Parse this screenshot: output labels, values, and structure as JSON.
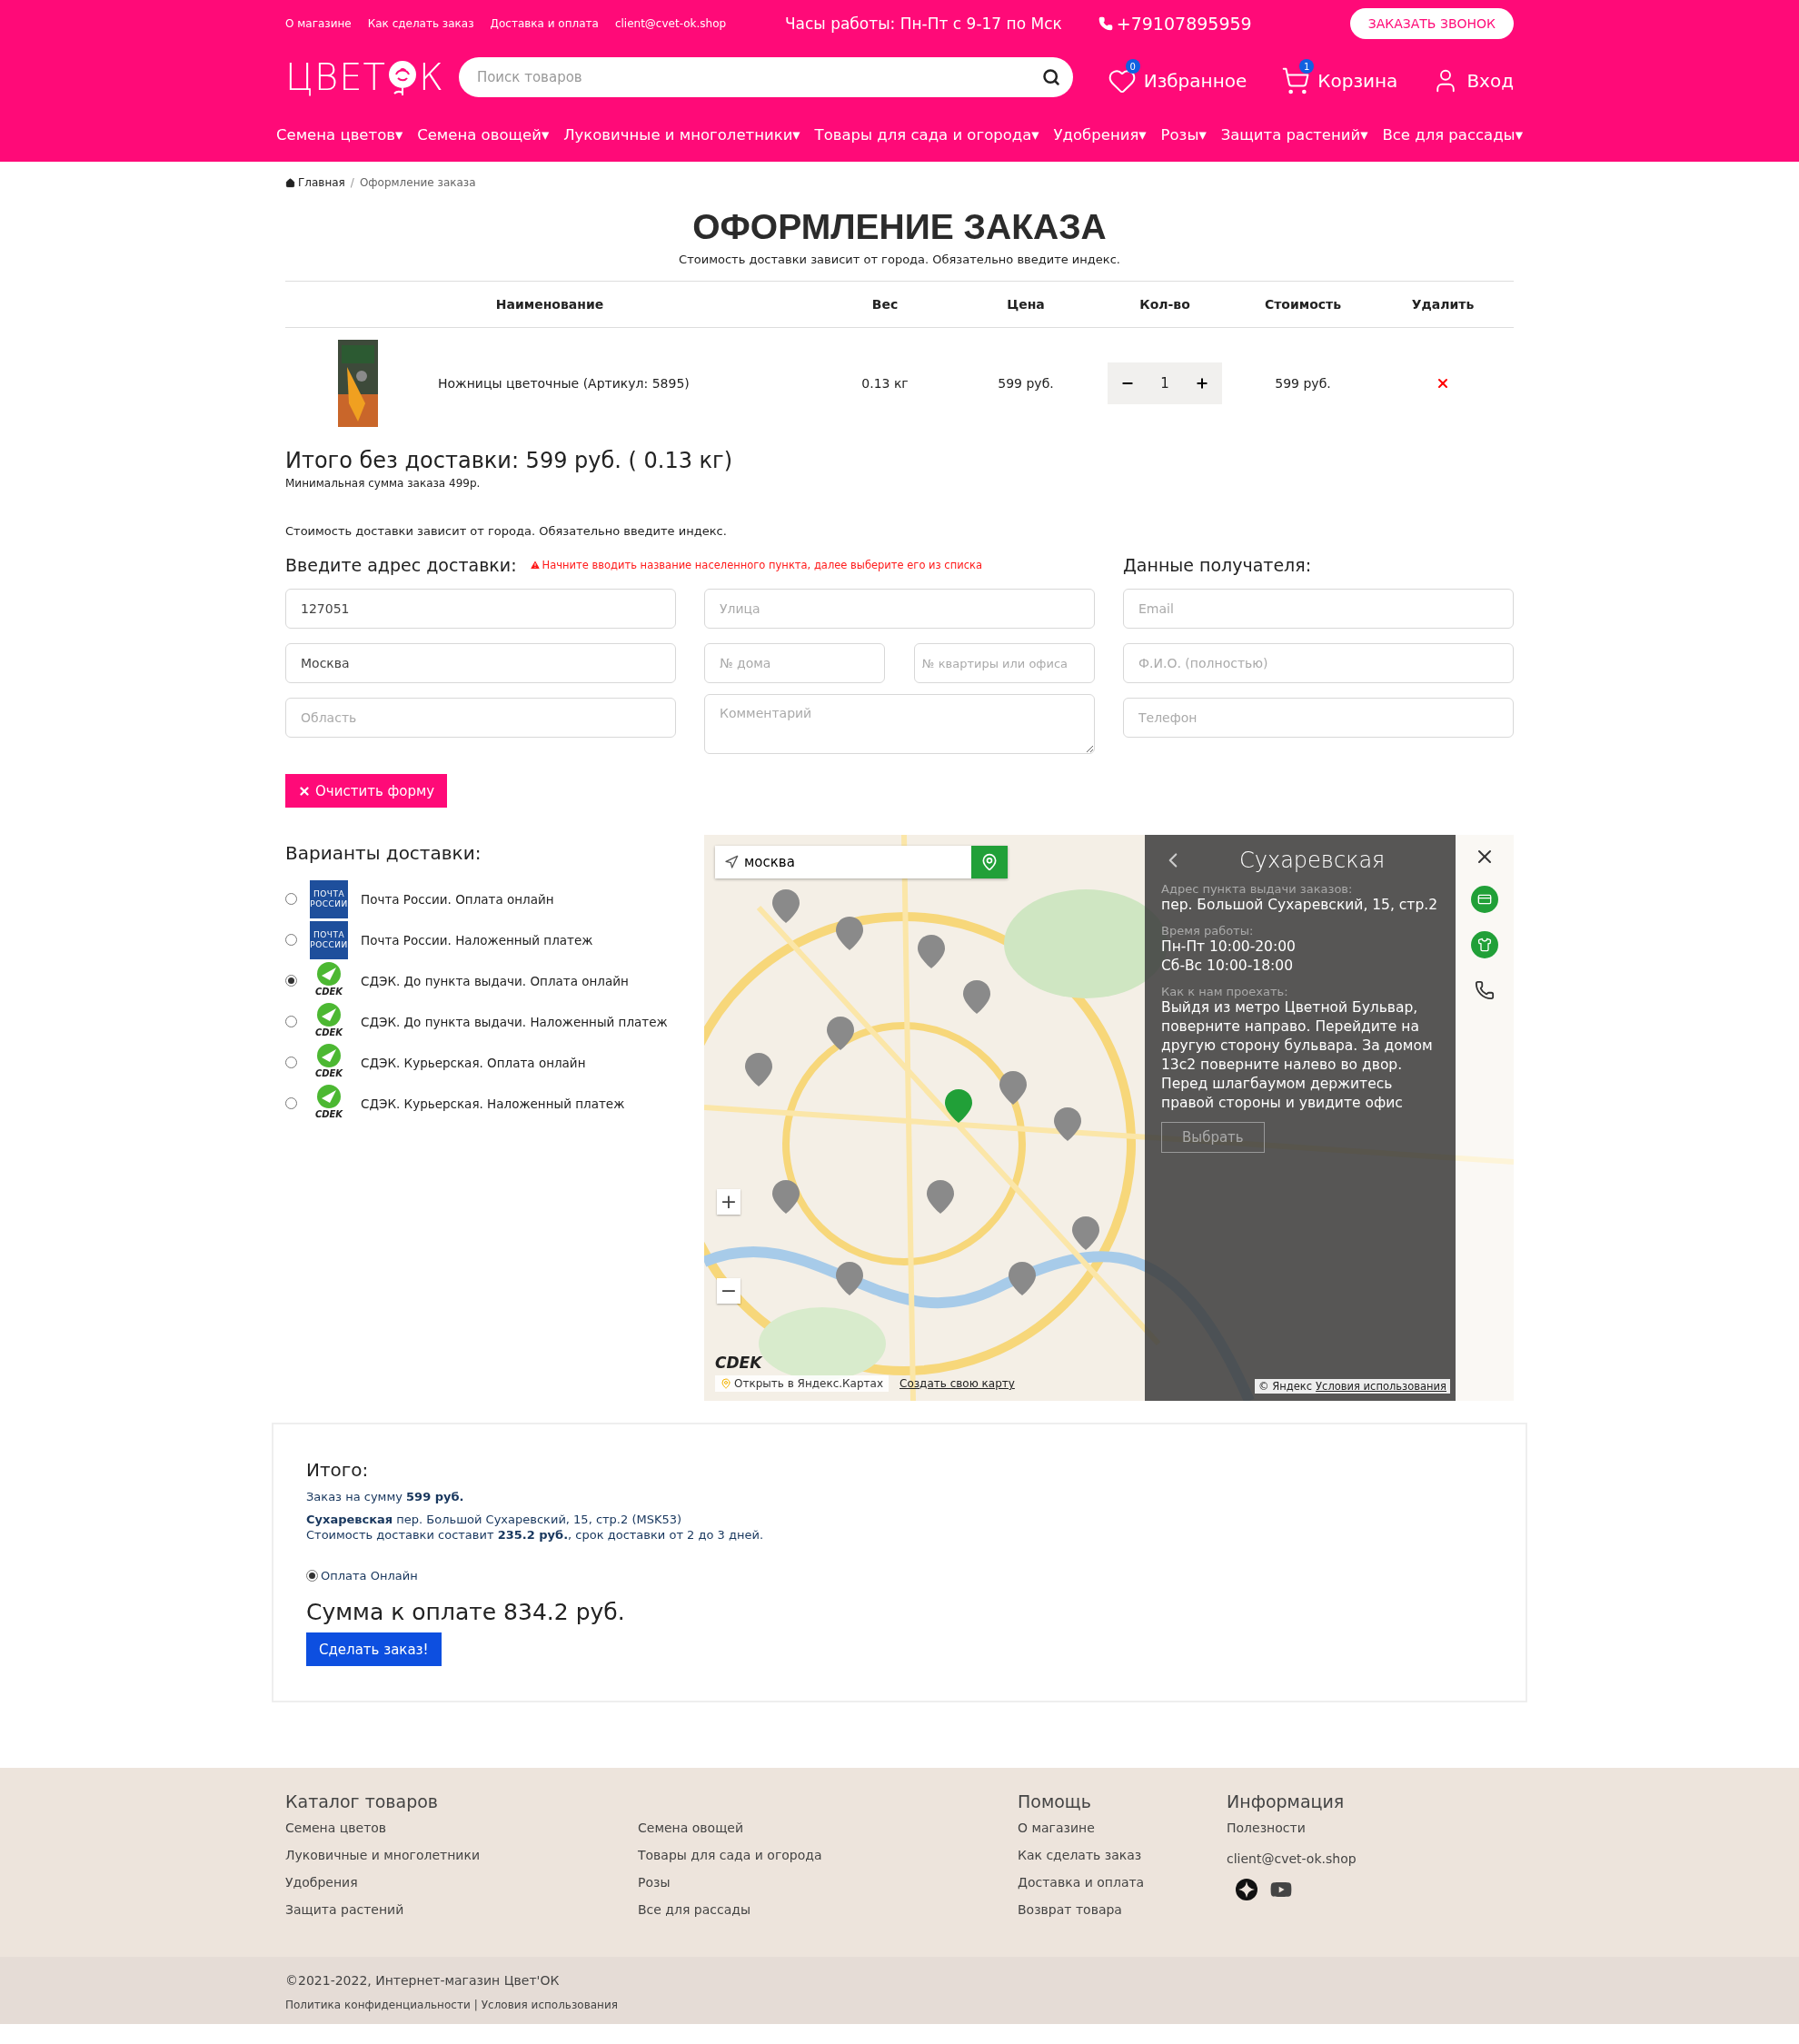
{
  "top_bar": {
    "links": [
      "О магазине",
      "Как сделать заказ",
      "Доставка и оплата",
      "client@cvet-ok.shop"
    ],
    "hours": "Часы работы: Пн-Пт с 9-17 по Мск",
    "phone": "+79107895959",
    "callback_button": "ЗАКАЗАТЬ ЗВОНОК"
  },
  "header": {
    "logo_left": "ЦВЕТ",
    "logo_right": "К",
    "search_placeholder": "Поиск товаров",
    "favorites": {
      "label": "Избранное",
      "count": "0"
    },
    "cart": {
      "label": "Корзина",
      "count": "1"
    },
    "login": "Вход"
  },
  "nav_caret": "▾",
  "breadcrumb_separator": "/",
  "nav": [
    "Семена цветов",
    "Семена овощей",
    "Луковичные и многолетники",
    "Товары для сада и огорода",
    "Удобрения",
    "Розы",
    "Защита растений",
    "Все для рассады"
  ],
  "breadcrumb": [
    {
      "label": "Главная",
      "kind": "home"
    },
    {
      "label": "Оформление заказа",
      "kind": "current"
    }
  ],
  "page": {
    "title": "ОФОРМЛЕНИЕ ЗАКАЗА",
    "subtitle": "Стоимость доставки зависит от города. Обязательно введите индекс."
  },
  "cart_table": {
    "columns": [
      "Наименование",
      "Вес",
      "Цена",
      "Кол-во",
      "Стоимость",
      "Удалить"
    ],
    "rows": [
      {
        "name": "Ножницы цветочные (Артикул: 5895)",
        "weight": "0.13 кг",
        "price": "599 руб.",
        "quantity": "1",
        "cost": "599 руб."
      }
    ]
  },
  "summary": {
    "title": "Итого без доставки: 599 руб. ( 0.13 кг)",
    "min_note": "Минимальная сумма заказа 499р."
  },
  "delivery_note": "Стоимость доставки зависит от города. Обязательно введите индекс.",
  "address": {
    "title": "Введите адрес доставки:",
    "warning": "Начните вводить название населенного пункта, далее выберите его из списка",
    "left_fields": [
      {
        "value": "127051"
      },
      {
        "value": "Москва"
      },
      {
        "placeholder": "Область"
      }
    ],
    "street": {
      "placeholder": "Улица"
    },
    "house": {
      "placeholder": "№ дома"
    },
    "flat": {
      "placeholder": "№ квартиры или офиса"
    },
    "comment": {
      "placeholder": "Комментарий"
    }
  },
  "recipient": {
    "title": "Данные получателя:",
    "fields": [
      {
        "placeholder": "Email"
      },
      {
        "placeholder": "Ф.И.О. (полностью)"
      },
      {
        "placeholder": "Телефон"
      }
    ]
  },
  "clear_button": "Очистить форму",
  "delivery": {
    "title": "Варианты доставки:",
    "options": [
      {
        "label": "Почта России. Оплата онлайн",
        "kind": "pochta",
        "logo": "ПОЧТА РОССИИ",
        "selected": false
      },
      {
        "label": "Почта России. Наложенный платеж",
        "kind": "pochta",
        "logo": "ПОЧТА РОССИИ",
        "selected": false
      },
      {
        "label": "СДЭК. До пункта выдачи. Оплата онлайн",
        "kind": "cdek",
        "logo": "CDEK",
        "selected": true
      },
      {
        "label": "СДЭК. До пункта выдачи. Наложенный платеж",
        "kind": "cdek",
        "logo": "CDEK",
        "selected": false
      },
      {
        "label": "СДЭК. Курьерская. Оплата онлайн",
        "kind": "cdek",
        "logo": "CDEK",
        "selected": false
      },
      {
        "label": "СДЭК. Курьерская. Наложенный платеж",
        "kind": "cdek",
        "logo": "CDEK",
        "selected": false
      }
    ]
  },
  "map": {
    "kind": "picture",
    "search_value": "москва",
    "zoom_in": "+",
    "zoom_out": "−",
    "brand": "CDEK",
    "open_link": "Открыть в Яндекс.Картах",
    "create_link": "Создать свою карту",
    "copyright": "© Яндекс",
    "terms_link": "Условия использования",
    "panel": {
      "title": "Сухаревская",
      "sections": [
        {
          "label": "Адрес пункта выдачи заказов:",
          "lines": [
            "пер. Большой Сухаревский, 15, стр.2"
          ]
        },
        {
          "label": "Время работы:",
          "lines": [
            "Пн-Пт 10:00-20:00",
            "Сб-Вс 10:00-18:00"
          ]
        },
        {
          "label": "Как к нам проехать:",
          "lines": [
            "Выйдя из метро Цветной Бульвар, поверните направо. Перейдите на другую сторону бульвара. За домом 13с2 поверните налево во двор. Перед шлагбаумом держитесь правой стороны и увидите офис"
          ]
        }
      ],
      "button": "Выбрать"
    }
  },
  "totals": {
    "title": "Итого:",
    "lines": [
      "Заказ на сумму **599 руб.**",
      "**Сухаревская** пер. Большой Сухаревский, 15, стр.2 (MSK53)",
      "Стоимость доставки составит **235.2 руб.**, срок доставки от 2 до 3 дней."
    ],
    "payment": {
      "label": "Оплата Онлайн",
      "selected": true
    },
    "total": "Сумма к оплате 834.2 руб.",
    "submit_button": "Сделать заказ!"
  },
  "footer": {
    "catalog_title": "Каталог товаров",
    "catalog_links": [
      "Семена цветов",
      "Луковичные и многолетники",
      "Удобрения",
      "Защита растений",
      "Семена овощей",
      "Товары для сада и огорода",
      "Розы",
      "Все для рассады"
    ],
    "help_title": "Помощь",
    "help_links": [
      "О магазине",
      "Как сделать заказ",
      "Доставка и оплата",
      "Возврат товара"
    ],
    "info_title": "Информация",
    "info_links": [
      "Полезности"
    ],
    "email": "client@cvet-ok.shop",
    "copyright": "©2021-2022, Интернет-магазин Цвет'ОК",
    "policy_links": [
      "Политика конфиденциальности",
      "Условия использования"
    ],
    "policy_separator": "|"
  }
}
